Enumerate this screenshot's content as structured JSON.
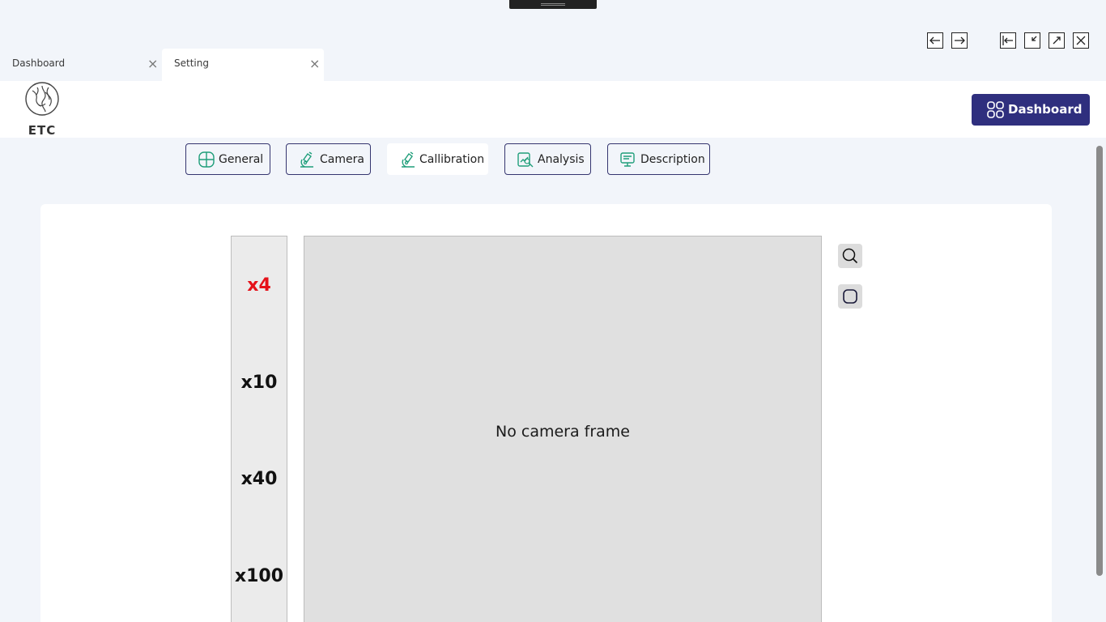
{
  "tabs": [
    {
      "label": "Dashboard",
      "active": false
    },
    {
      "label": "Setting",
      "active": true
    }
  ],
  "window_controls": [
    "arrow-left-icon",
    "arrow-right-icon",
    "enter-icon",
    "minimize-icon",
    "maximize-icon",
    "close-icon"
  ],
  "header": {
    "logo_text": "ETC",
    "dashboard_button": "Dashboard"
  },
  "subtabs": [
    {
      "label": "General",
      "icon": "grid-circle-icon",
      "active": false
    },
    {
      "label": "Camera",
      "icon": "microscope-icon",
      "active": false
    },
    {
      "label": "Callibration",
      "icon": "microscope-icon",
      "active": true
    },
    {
      "label": "Analysis",
      "icon": "analysis-icon",
      "active": false
    },
    {
      "label": "Description",
      "icon": "description-icon",
      "active": false
    }
  ],
  "magnifications": [
    {
      "label": "x4",
      "selected": true
    },
    {
      "label": "x10",
      "selected": false
    },
    {
      "label": "x40",
      "selected": false
    },
    {
      "label": "x100",
      "selected": false
    }
  ],
  "camera": {
    "placeholder_text": "No camera frame"
  },
  "tools": [
    "search-icon",
    "rounded-square-icon"
  ],
  "colors": {
    "accent": "#2f2f7e",
    "icon_green": "#1f9e7a",
    "selected_magnification": "#e5121a",
    "background": "#f2f5fa"
  }
}
